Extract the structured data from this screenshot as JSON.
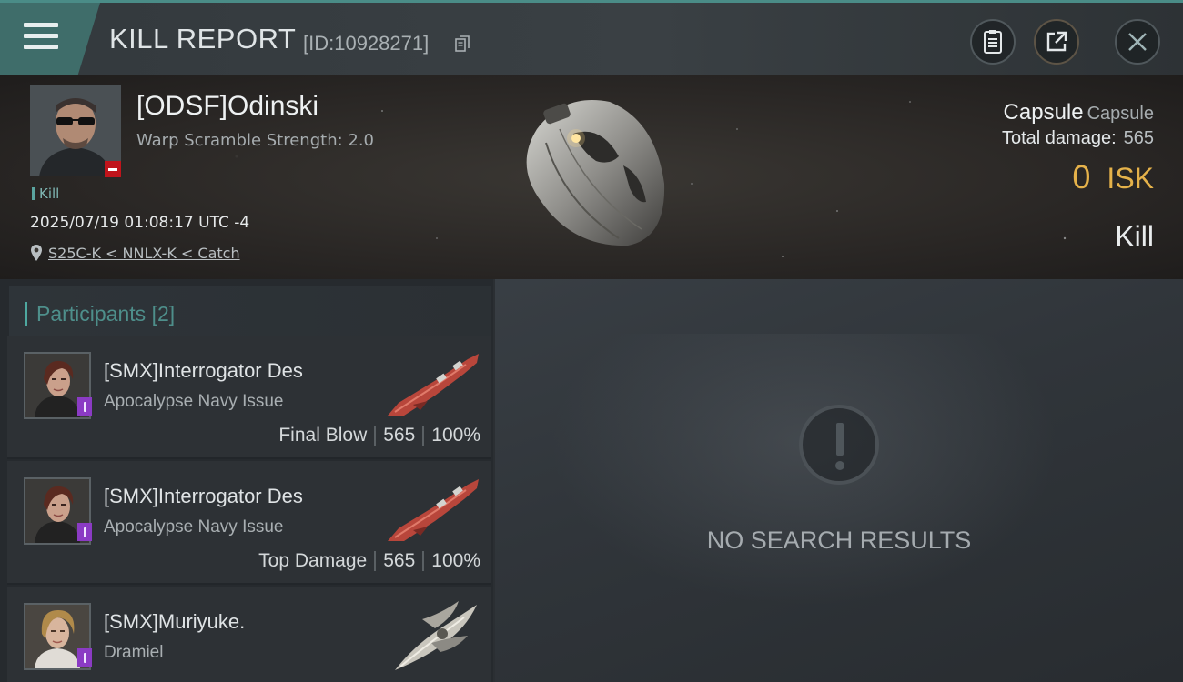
{
  "header": {
    "title": "KILL REPORT",
    "report_id": "[ID:10928271]",
    "icons": {
      "menu": "menu-icon",
      "copy": "copy-icon",
      "clipboard": "clipboard-icon",
      "share": "share-icon",
      "close": "close-icon"
    }
  },
  "victim": {
    "name": "[ODSF]Odinski",
    "warp_scramble": "Warp Scramble Strength: 2.0",
    "tag": "Kill",
    "datetime": "2025/07/19 01:08:17 UTC -4",
    "location": "S25C-K < NNLX-K < Catch",
    "ship_name": "Capsule",
    "ship_class": "Capsule",
    "total_damage_label": "Total damage:",
    "total_damage": "565",
    "isk_value": "0",
    "isk_unit": "ISK",
    "type": "Kill"
  },
  "participants": {
    "title": "Participants",
    "count": "[2]",
    "items": [
      {
        "name": "[SMX]Interrogator Des",
        "ship": "Apocalypse Navy Issue",
        "role": "Final Blow",
        "damage": "565",
        "percent": "100%"
      },
      {
        "name": "[SMX]Interrogator Des",
        "ship": "Apocalypse Navy Issue",
        "role": "Top Damage",
        "damage": "565",
        "percent": "100%"
      },
      {
        "name": "[SMX]Muriyuke.",
        "ship": "Dramiel"
      }
    ]
  },
  "results": {
    "empty_text": "NO SEARCH RESULTS"
  },
  "colors": {
    "accent_teal": "#4ea8a0",
    "isk_gold": "#e5b24a",
    "badge_red": "#c0141b",
    "badge_purple": "#8b3bc4"
  }
}
